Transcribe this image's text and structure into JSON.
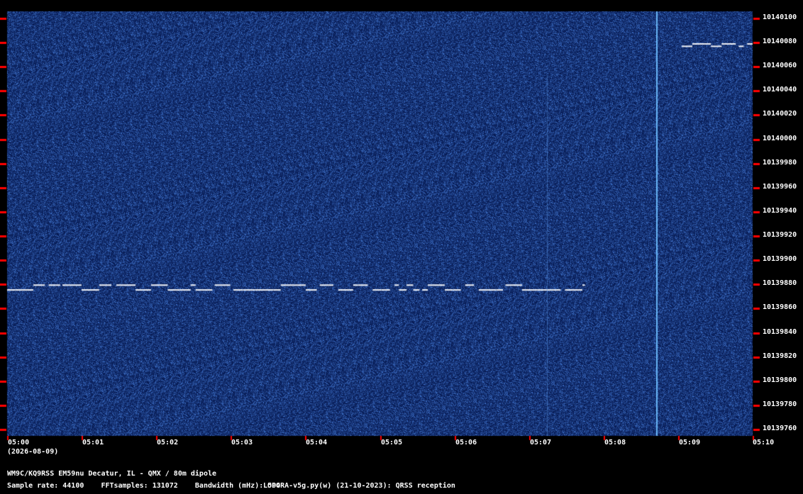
{
  "chart_data": {
    "type": "heatmap",
    "x_ticks": [
      "05:00",
      "05:01",
      "05:02",
      "05:03",
      "05:04",
      "05:05",
      "05:06",
      "05:07",
      "05:08",
      "05:09",
      "05:10"
    ],
    "y_ticks": [
      "10140100",
      "10140080",
      "10140060",
      "10140040",
      "10140020",
      "10140000",
      "10139980",
      "10139960",
      "10139940",
      "10139920",
      "10139900",
      "10139880",
      "10139860",
      "10139840",
      "10139820",
      "10139800",
      "10139780",
      "10139760"
    ],
    "date": "(2026-08-09)",
    "xlim_minutes": [
      0,
      10
    ],
    "ylim_hz": [
      10139754,
      10140106
    ],
    "colors": {
      "background": "#0b1f5c",
      "signal": "#ffffff",
      "tick": "#ff0000"
    },
    "traces": [
      {
        "kind": "fsk-cw",
        "freq_hz": 10139875,
        "shift_hz": 4,
        "t_start_min": 0.0,
        "t_end_min": 7.75
      },
      {
        "kind": "fsk-cw",
        "freq_hz": 10140077,
        "shift_hz": 2,
        "t_start_min": 9.05,
        "t_end_min": 10.0
      },
      {
        "kind": "vertical-line",
        "t_min": 8.72
      },
      {
        "kind": "vertical-line-faint",
        "t_min": 7.24
      }
    ]
  },
  "footer": {
    "station": "WM9C/KQ9RSS EM59nu Decatur, IL - QMX / 80m dipole",
    "params": "Sample rate: 44100    FFTsamples: 131072    Bandwidth (mHz): 504",
    "software": "LOPORA-v5g.py(w) (21-10-2023): QRSS reception"
  }
}
